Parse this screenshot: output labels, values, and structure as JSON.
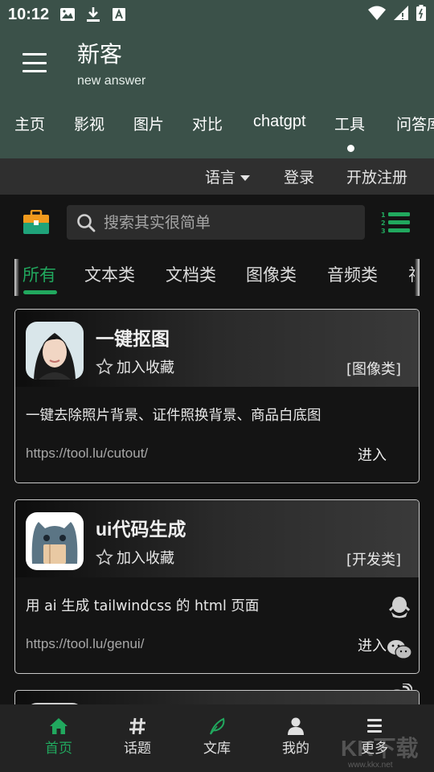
{
  "status_bar": {
    "time": "10:12",
    "icons": [
      "image-icon",
      "download-icon",
      "font-icon",
      "wifi-icon",
      "sim-icon",
      "battery-icon"
    ]
  },
  "header": {
    "title": "新客",
    "subtitle": "new answer",
    "tabs": [
      "主页",
      "影视",
      "图片",
      "对比",
      "chatgpt",
      "工具",
      "问答库"
    ],
    "active_tab": "工具"
  },
  "sub_bar": {
    "language": "语言",
    "login": "登录",
    "register": "开放注册"
  },
  "search": {
    "placeholder": "搜索其实很简单",
    "value": ""
  },
  "categories": {
    "items": [
      "所有",
      "文本类",
      "文档类",
      "图像类",
      "音频类",
      "视频类"
    ],
    "active": "所有"
  },
  "cards": [
    {
      "title": "一键抠图",
      "favorite_label": "加入收藏",
      "category": "[图像类]",
      "description": "一键去除照片背景、证件照换背景、商品白底图",
      "url": "https://tool.lu/cutout/",
      "enter_label": "进入"
    },
    {
      "title": "ui代码生成",
      "favorite_label": "加入收藏",
      "category": "[开发类]",
      "description": "用 ai 生成 tailwindcss 的 html 页面",
      "url": "https://tool.lu/genui/",
      "enter_label": "进入"
    }
  ],
  "bottom_nav": [
    {
      "label": "首页",
      "icon": "home-icon",
      "active": true
    },
    {
      "label": "话题",
      "icon": "hashtag-icon",
      "active": false
    },
    {
      "label": "文库",
      "icon": "feather-icon",
      "active": false
    },
    {
      "label": "我的",
      "icon": "user-icon",
      "active": false
    },
    {
      "label": "更多",
      "icon": "menu-icon",
      "active": false
    }
  ],
  "watermark": {
    "text": "KK下载",
    "url": "www.kkx.net"
  },
  "colors": {
    "header_bg": "#3b5149",
    "accent": "#21a85e",
    "page_bg": "#141414"
  }
}
